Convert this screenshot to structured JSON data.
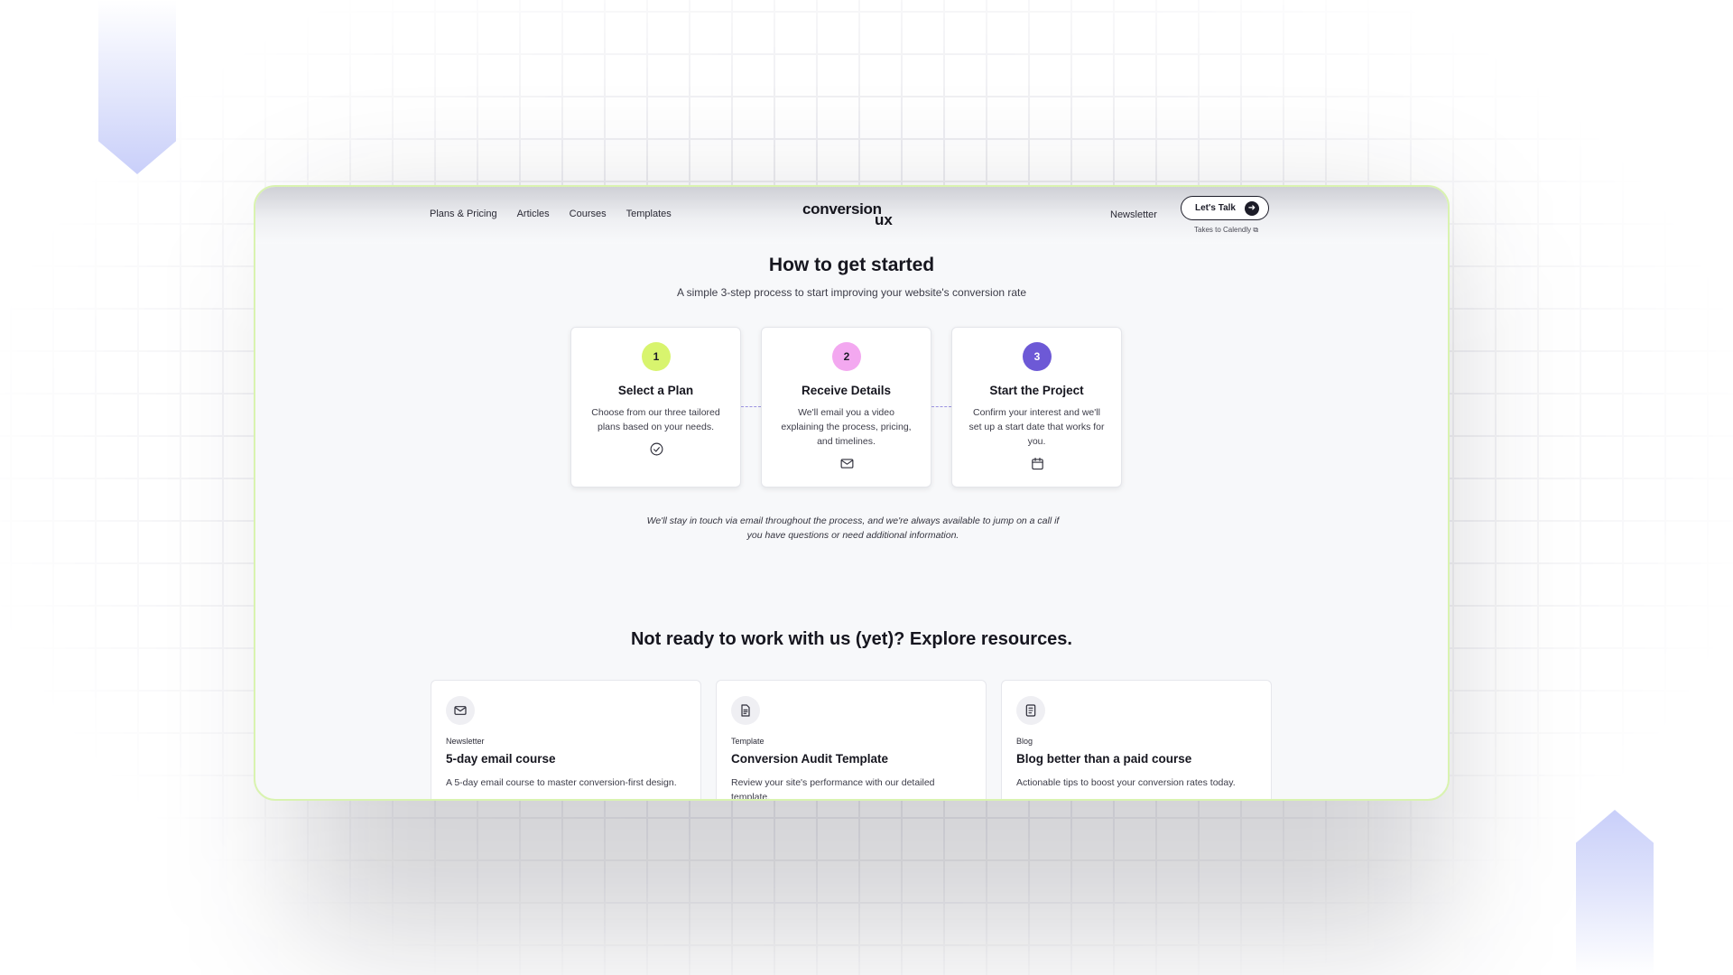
{
  "nav": {
    "links": [
      "Plans & Pricing",
      "Articles",
      "Courses",
      "Templates"
    ],
    "logo_main": "conversion",
    "logo_sub": "ux",
    "newsletter": "Newsletter",
    "cta_label": "Let's Talk",
    "cta_note": "Takes to Calendly ⧉"
  },
  "intro": {
    "title": "How to get started",
    "subtitle": "A simple 3-step process to start improving your website's conversion rate"
  },
  "steps": [
    {
      "num": "1",
      "title": "Select a Plan",
      "desc": "Choose from our three tailored plans based on your needs.",
      "icon": "check-circle-icon",
      "color": "#d8f46e",
      "text_color": "#1c1c28"
    },
    {
      "num": "2",
      "title": "Receive Details",
      "desc": "We'll email you a video explaining the process, pricing, and timelines.",
      "icon": "mail-icon",
      "color": "#f3a8f0",
      "text_color": "#1c1c28"
    },
    {
      "num": "3",
      "title": "Start the Project",
      "desc": "Confirm your interest and we'll set up a start date that works for you.",
      "icon": "calendar-icon",
      "color": "#6d59d6",
      "text_color": "#ffffff"
    }
  ],
  "note": "We'll stay in touch via email throughout the process, and we're always available to jump on a call if you have questions or need additional information.",
  "resources": {
    "title": "Not ready to work with us (yet)? Explore resources.",
    "items": [
      {
        "category": "Newsletter",
        "title": "5-day email course",
        "desc": "A 5-day email course to master conversion-first design.",
        "icon": "mail-icon"
      },
      {
        "category": "Template",
        "title": "Conversion Audit Template",
        "desc": "Review your site's performance with our detailed template.",
        "icon": "document-icon"
      },
      {
        "category": "Blog",
        "title": "Blog better than a paid course",
        "desc": "Actionable tips to boost your conversion rates today.",
        "icon": "notebook-icon"
      }
    ]
  },
  "colors": {
    "accent_green": "#d8f46e",
    "accent_pink": "#f3a8f0",
    "accent_purple": "#6d59d6",
    "frame_border": "#d9f3b0"
  }
}
